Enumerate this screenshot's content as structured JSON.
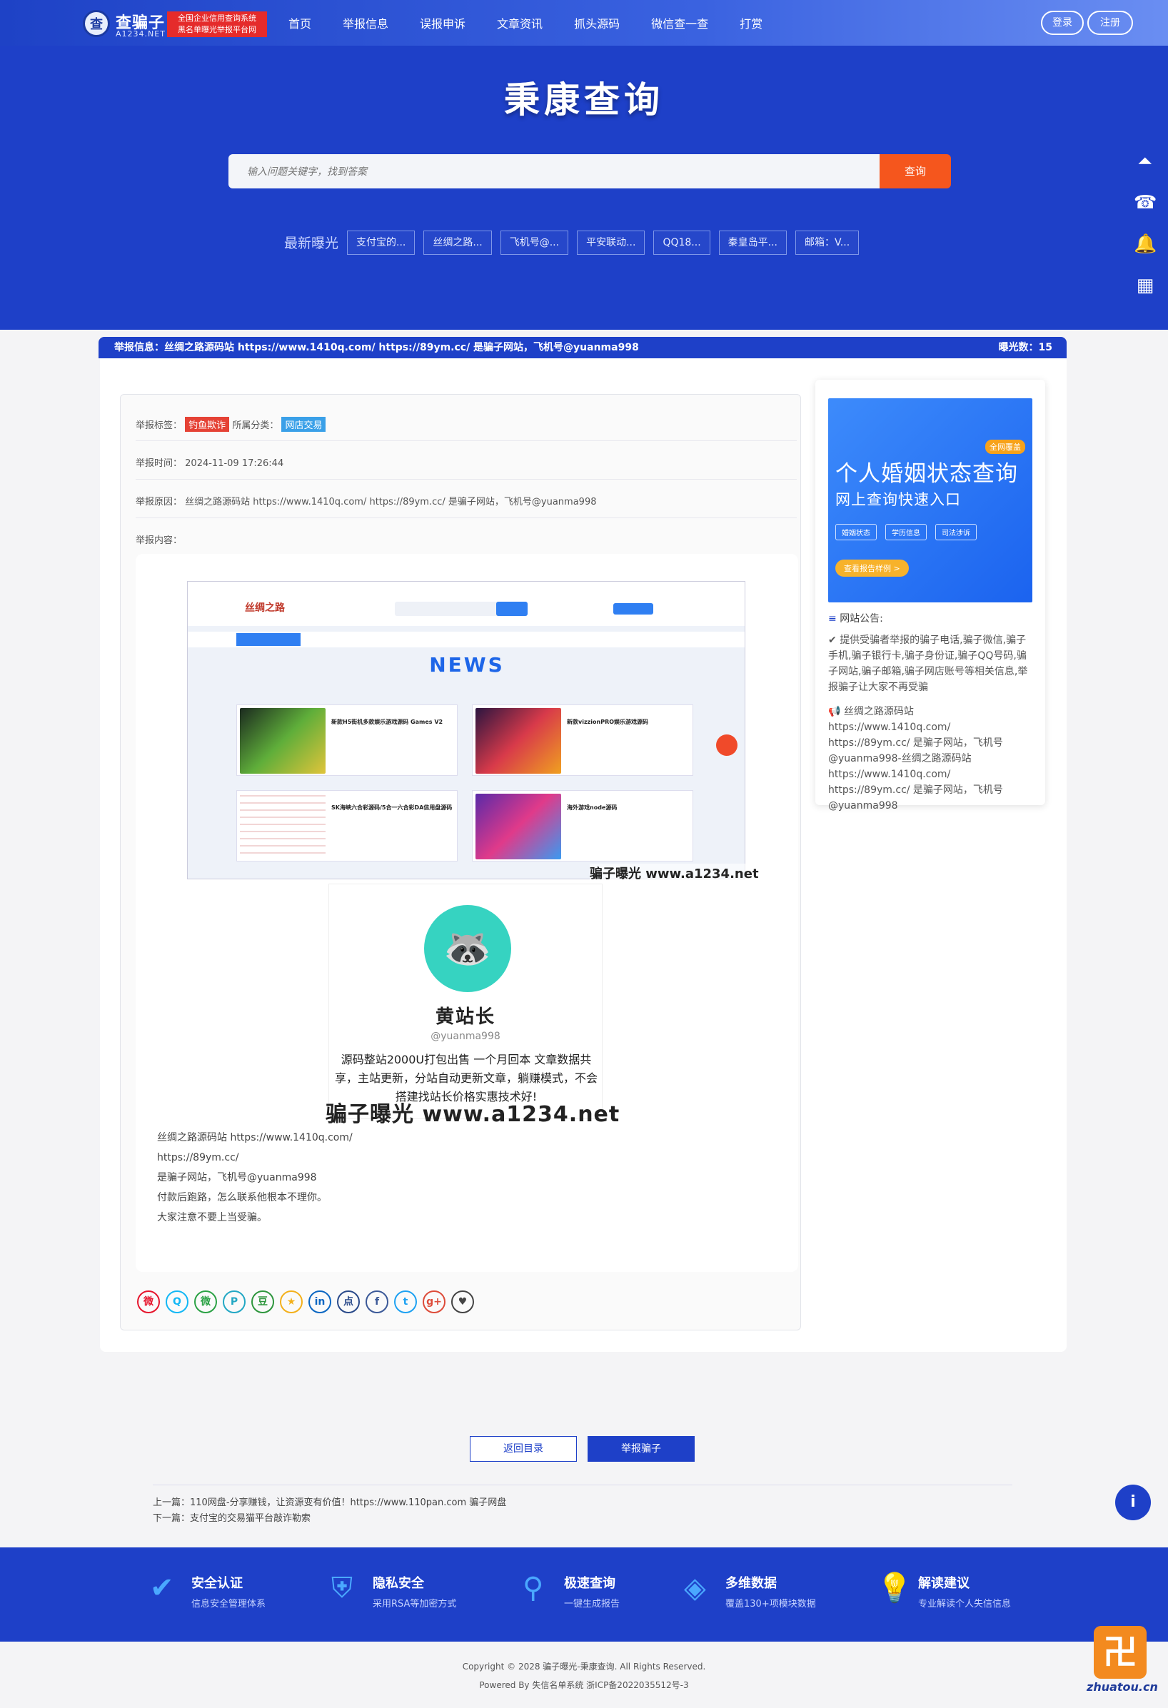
{
  "header": {
    "logo_text": "查",
    "site_title": "查骗子",
    "site_domain": "A1234.NET",
    "badge_line1": "全国企业信用查询系统",
    "badge_line2": "黑名单曝光举报平台网",
    "nav": [
      "首页",
      "举报信息",
      "误报申诉",
      "文章资讯",
      "抓头源码",
      "微信查一查",
      "打赏"
    ],
    "login": "登录",
    "register": "注册"
  },
  "hero": {
    "title": "秉康查询",
    "search_placeholder": "输入问题关键字，找到答案",
    "search_button": "查询",
    "latest_label": "最新曝光",
    "tags": [
      "支付宝的...",
      "丝绸之路...",
      "飞机号@...",
      "平安联动...",
      "QQ18...",
      "秦皇岛平...",
      "邮箱：V..."
    ]
  },
  "side_tools": [
    "⏶",
    "☎",
    "🔔",
    "▦"
  ],
  "report": {
    "bar_title": "举报信息：丝绸之路源码站 https://www.1410q.com/ https://89ym.cc/ 是骗子网站，飞机号@yuanma998",
    "views_label": "曝光数：15",
    "tag_label": "举报标签：",
    "tag_value": "钓鱼欺诈",
    "category_label": "所属分类：",
    "category_value": "网店交易",
    "time_label": "举报时间：",
    "time_value": "2024-11-09 17:26:44",
    "reason_label": "举报原因：",
    "reason_value": "丝绸之路源码站 https://www.1410q.com/ https://89ym.cc/ 是骗子网站，飞机号@yuanma998",
    "content_label": "举报内容："
  },
  "screenshot": {
    "brand": "丝绸之路",
    "news_title": "NEWS",
    "cards": [
      {
        "title": "新款H5街机多款娱乐游戏源码 Games V2"
      },
      {
        "title": "新款vizzionPRO娱乐游戏源码"
      },
      {
        "title": "SK海峡六合彩源码/5合一六合彩DA信用盘源码"
      },
      {
        "title": "海外游戏node源码"
      }
    ],
    "watermark": "骗子曝光 www.a1234.net"
  },
  "profile": {
    "avatar": "🦝",
    "name": "黄站长",
    "username": "@yuanma998",
    "description": "源码整站2000U打包出售 一个月回本 文章数据共享，主站更新，分站自动更新文章，躺赚模式，不会搭建找站长价格实惠技术好!",
    "watermark": "骗子曝光 www.a1234.net"
  },
  "body_lines": [
    "丝绸之路源码站 https://www.1410q.com/",
    "https://89ym.cc/",
    "是骗子网站，飞机号@yuanma998",
    "付款后跑路，怎么联系他根本不理你。",
    "大家注意不要上当受骗。"
  ],
  "share_icons": [
    {
      "name": "weibo-icon",
      "glyph": "微",
      "color": "#e6162d"
    },
    {
      "name": "qq-icon",
      "glyph": "Q",
      "color": "#12b7f5"
    },
    {
      "name": "wechat-icon",
      "glyph": "微",
      "color": "#2ba245"
    },
    {
      "name": "pinterest-icon",
      "glyph": "P",
      "color": "#22a7c4"
    },
    {
      "name": "douban-icon",
      "glyph": "豆",
      "color": "#2e963d"
    },
    {
      "name": "qzone-icon",
      "glyph": "★",
      "color": "#f3b01b"
    },
    {
      "name": "linkedin-icon",
      "glyph": "in",
      "color": "#0a66c2"
    },
    {
      "name": "dianping-icon",
      "glyph": "点",
      "color": "#2a4a8a"
    },
    {
      "name": "facebook-icon",
      "glyph": "f",
      "color": "#3b5998"
    },
    {
      "name": "twitter-icon",
      "glyph": "t",
      "color": "#1da1f2"
    },
    {
      "name": "googleplus-icon",
      "glyph": "g+",
      "color": "#dd4b39"
    },
    {
      "name": "favorite-icon",
      "glyph": "♥",
      "color": "#444444"
    }
  ],
  "ad": {
    "title": "个人婚姻状态查询",
    "subtitle": "网上查询快速入口",
    "badge": "全网覆盖",
    "chips": [
      "婚姻状态",
      "学历信息",
      "司法涉诉"
    ],
    "cta": "查看报告样例 >"
  },
  "notice": {
    "label": "网站公告:",
    "item1": "提供受骗者举报的骗子电话,骗子微信,骗子手机,骗子银行卡,骗子身份证,骗子QQ号码,骗子网站,骗子邮箱,骗子网店账号等相关信息,举报骗子让大家不再受骗",
    "item2": "丝绸之路源码站 https://www.1410q.com/ https://89ym.cc/ 是骗子网站，飞机号@yuanma998-丝绸之路源码站 https://www.1410q.com/ https://89ym.cc/ 是骗子网站，飞机号@yuanma998"
  },
  "actions": {
    "back": "返回目录",
    "report": "举报骗子"
  },
  "pagination": {
    "prev": "上一篇：110网盘-分享赚钱，让资源变有价值！https://www.110pan.com 骗子网盘",
    "next": "下一篇：支付宝的交易猫平台敲诈勒索"
  },
  "info_button": "i",
  "features": [
    {
      "icon": "✔",
      "title": "安全认证",
      "subtitle": "信息安全管理体系"
    },
    {
      "icon": "⛨",
      "title": "隐私安全",
      "subtitle": "采用RSA等加密方式"
    },
    {
      "icon": "⚲",
      "title": "极速查询",
      "subtitle": "一键生成报告"
    },
    {
      "icon": "◈",
      "title": "多维数据",
      "subtitle": "覆盖130+项模块数据"
    },
    {
      "icon": "💡",
      "title": "解读建议",
      "subtitle": "专业解读个人失信信息"
    }
  ],
  "footer": {
    "copyright": "Copyright © 2028 骗子曝光-秉康查询. All Rights Reserved.",
    "powered": "Powered By 失信名单系统  浙ICP备2022035512号-3"
  },
  "corner_logo": {
    "glyph": "卍",
    "text": "zhuatou.cn"
  }
}
